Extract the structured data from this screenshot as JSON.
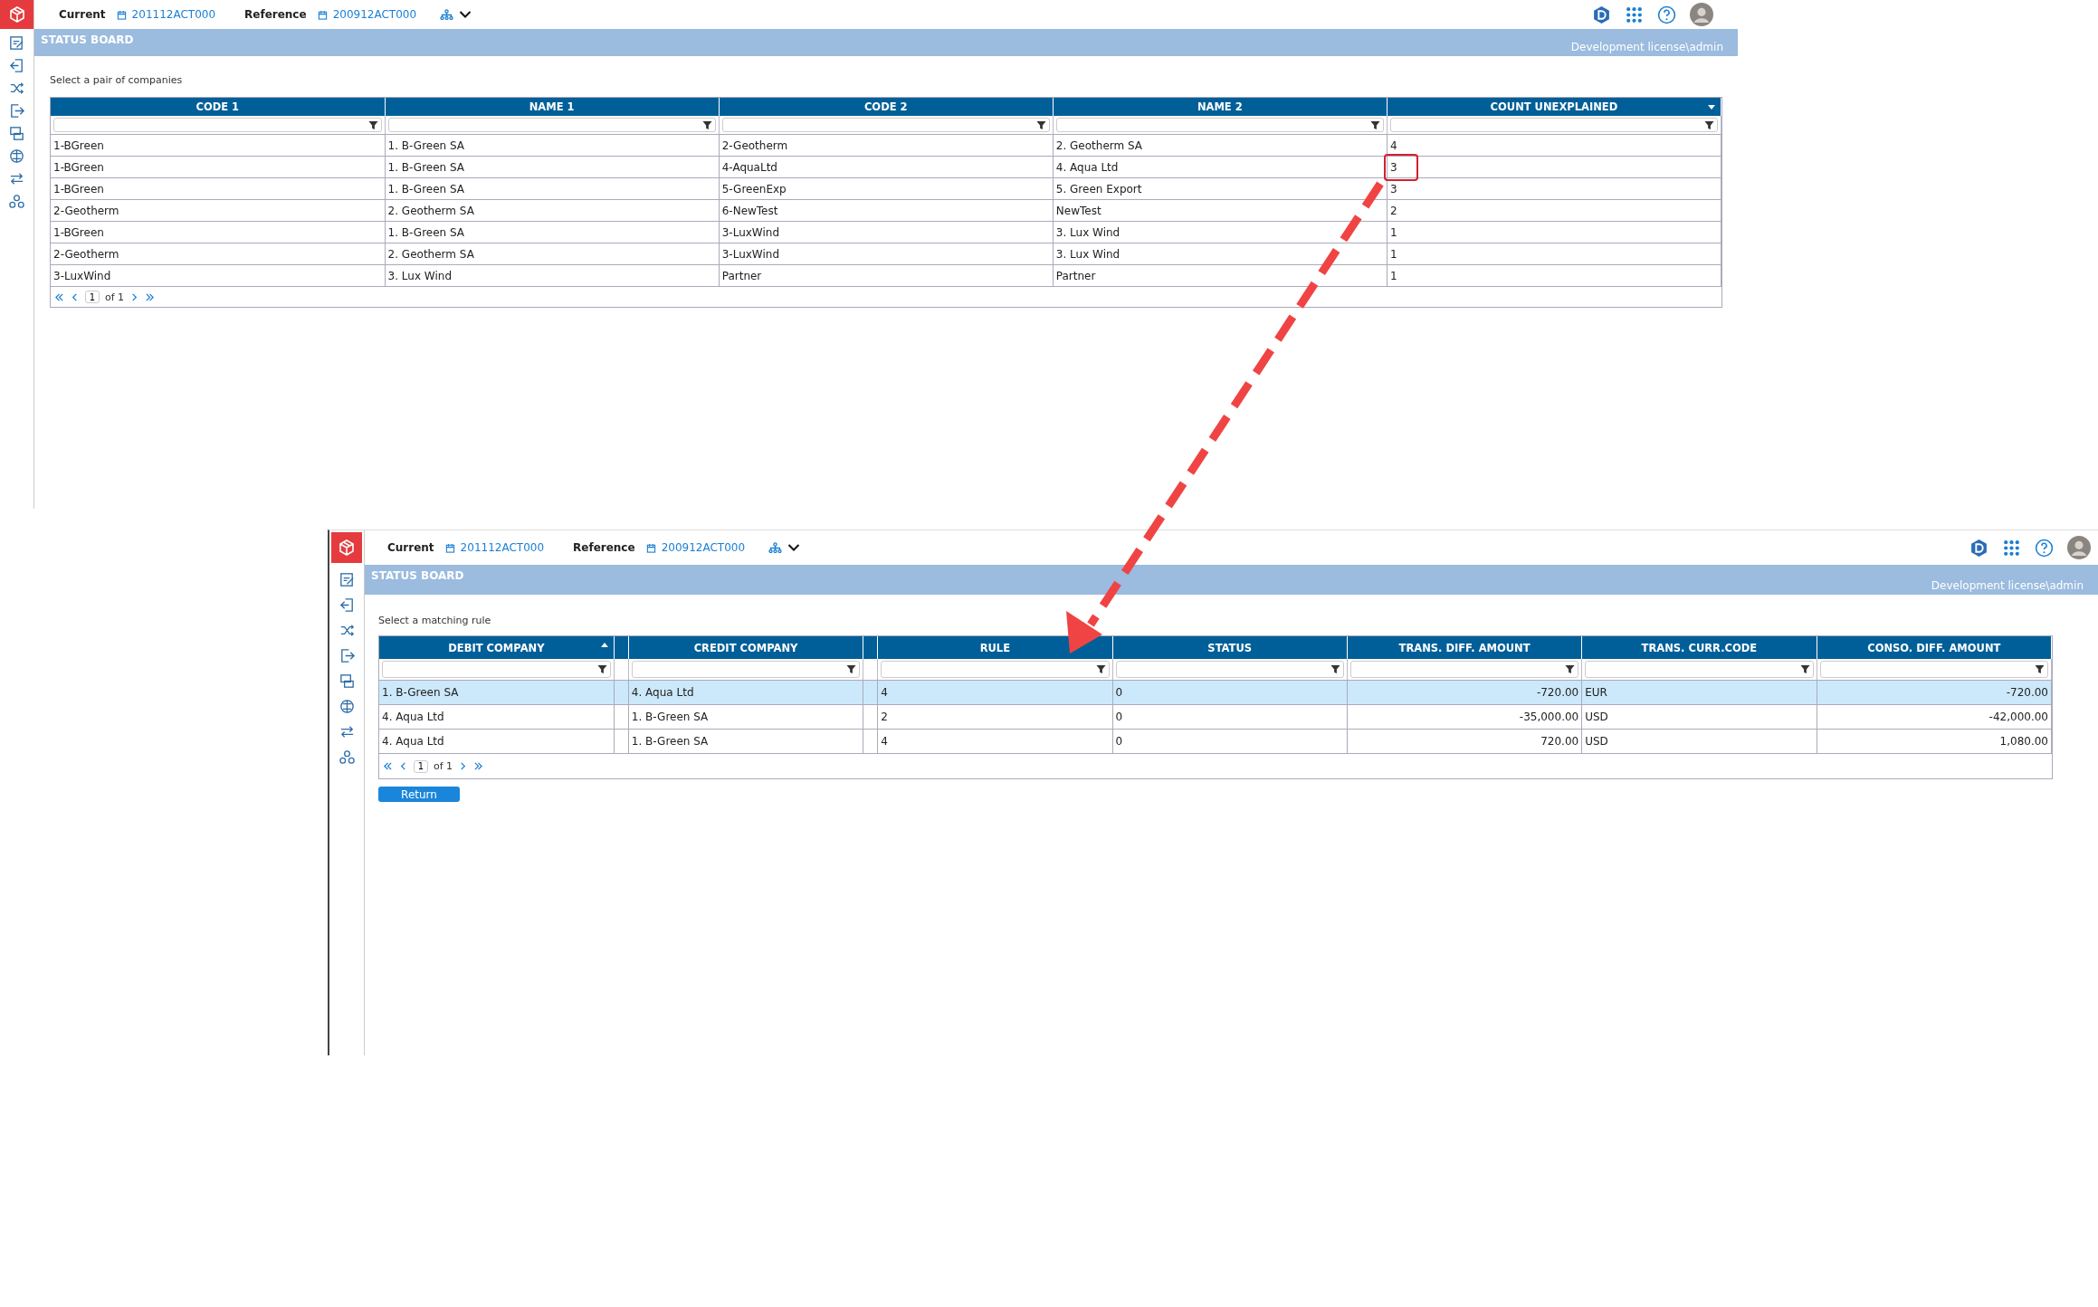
{
  "screens": [
    {
      "header": {
        "current_label": "Current",
        "current_value": "201112ACT000",
        "reference_label": "Reference",
        "reference_value": "200912ACT000"
      },
      "status_board": {
        "title": "STATUS BOARD",
        "license": "Development license\\admin"
      },
      "prompt": "Select a pair of companies",
      "table": {
        "columns": [
          {
            "label": "CODE 1",
            "sort_ascending": false,
            "sort_descending": false,
            "kind": "text",
            "spacer_after": false
          },
          {
            "label": "NAME 1",
            "sort_ascending": false,
            "sort_descending": false,
            "kind": "text",
            "spacer_after": false
          },
          {
            "label": "CODE 2",
            "sort_ascending": false,
            "sort_descending": false,
            "kind": "text",
            "spacer_after": false
          },
          {
            "label": "NAME 2",
            "sort_ascending": false,
            "sort_descending": false,
            "kind": "text",
            "spacer_after": false
          },
          {
            "label": "COUNT UNEXPLAINED",
            "sort_ascending": false,
            "sort_descending": true,
            "kind": "text",
            "spacer_after": false
          }
        ],
        "rows": [
          {
            "cells": [
              "1-BGreen",
              "1. B-Green SA",
              "2-Geotherm",
              "2. Geotherm SA",
              "4"
            ],
            "selected": false,
            "marked": false
          },
          {
            "cells": [
              "1-BGreen",
              "1. B-Green SA",
              "4-AquaLtd",
              "4. Aqua Ltd",
              "3"
            ],
            "selected": false,
            "marked": true
          },
          {
            "cells": [
              "1-BGreen",
              "1. B-Green SA",
              "5-GreenExp",
              "5. Green Export",
              "3"
            ],
            "selected": false,
            "marked": false
          },
          {
            "cells": [
              "2-Geotherm",
              "2. Geotherm SA",
              "6-NewTest",
              "NewTest",
              "2"
            ],
            "selected": false,
            "marked": false
          },
          {
            "cells": [
              "1-BGreen",
              "1. B-Green SA",
              "3-LuxWind",
              "3. Lux Wind",
              "1"
            ],
            "selected": false,
            "marked": false
          },
          {
            "cells": [
              "2-Geotherm",
              "2. Geotherm SA",
              "3-LuxWind",
              "3. Lux Wind",
              "1"
            ],
            "selected": false,
            "marked": false
          },
          {
            "cells": [
              "3-LuxWind",
              "3. Lux Wind",
              "Partner",
              "Partner",
              "1"
            ],
            "selected": false,
            "marked": false
          }
        ]
      },
      "pager": {
        "page": "1",
        "total": "of 1"
      }
    },
    {
      "header": {
        "current_label": "Current",
        "current_value": "201112ACT000",
        "reference_label": "Reference",
        "reference_value": "200912ACT000"
      },
      "status_board": {
        "title": "STATUS BOARD",
        "license": "Development license\\admin"
      },
      "prompt": "Select a matching rule",
      "table": {
        "columns": [
          {
            "label": "DEBIT COMPANY",
            "sort_ascending": true,
            "sort_descending": false,
            "kind": "text",
            "spacer_after": true
          },
          {
            "label": "CREDIT COMPANY",
            "sort_ascending": false,
            "sort_descending": false,
            "kind": "text",
            "spacer_after": true
          },
          {
            "label": "RULE",
            "sort_ascending": false,
            "sort_descending": false,
            "kind": "text",
            "spacer_after": false
          },
          {
            "label": "STATUS",
            "sort_ascending": false,
            "sort_descending": false,
            "kind": "text",
            "spacer_after": false
          },
          {
            "label": "TRANS. DIFF. AMOUNT",
            "sort_ascending": false,
            "sort_descending": false,
            "kind": "number",
            "spacer_after": false
          },
          {
            "label": "TRANS. CURR.CODE",
            "sort_ascending": false,
            "sort_descending": false,
            "kind": "text",
            "spacer_after": false
          },
          {
            "label": "CONSO. DIFF. AMOUNT",
            "sort_ascending": false,
            "sort_descending": false,
            "kind": "number",
            "spacer_after": false
          }
        ],
        "rows": [
          {
            "cells": [
              "1. B-Green SA",
              "4. Aqua Ltd",
              "4",
              "0",
              "-720.00",
              "EUR",
              "-720.00"
            ],
            "selected": true,
            "marked": false
          },
          {
            "cells": [
              "4. Aqua Ltd",
              "1. B-Green SA",
              "2",
              "0",
              "-35,000.00",
              "USD",
              "-42,000.00"
            ],
            "selected": false,
            "marked": false
          },
          {
            "cells": [
              "4. Aqua Ltd",
              "1. B-Green SA",
              "4",
              "0",
              "720.00",
              "USD",
              "1,080.00"
            ],
            "selected": false,
            "marked": false
          }
        ]
      },
      "pager": {
        "page": "1",
        "total": "of 1"
      },
      "return_button": "Return"
    }
  ]
}
